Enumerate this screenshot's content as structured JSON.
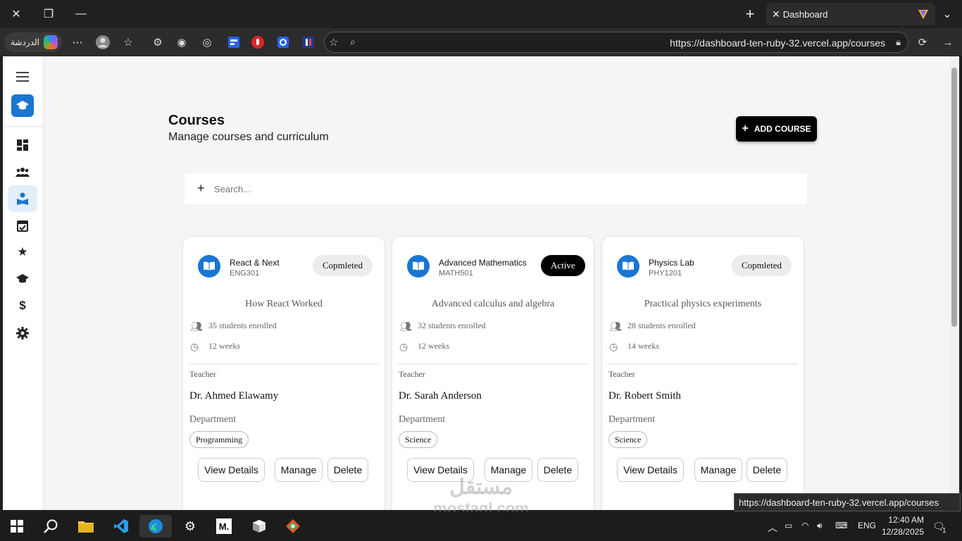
{
  "browser": {
    "tab_title": "Dashboard",
    "chat_label": "الدردشة",
    "url": "https://dashboard-ten-ruby-32.vercel.app/courses",
    "tooltip_url": "https://dashboard-ten-ruby-32.vercel.app/courses"
  },
  "sidebar": {
    "items": [
      {
        "name": "dashboard",
        "icon": "dashboard-icon"
      },
      {
        "name": "students",
        "icon": "people-icon"
      },
      {
        "name": "courses",
        "icon": "course-reader-icon",
        "active": true
      },
      {
        "name": "calendar",
        "icon": "calendar-check-icon"
      },
      {
        "name": "favorites",
        "icon": "star-icon"
      },
      {
        "name": "graduation",
        "icon": "graduation-cap-icon"
      },
      {
        "name": "payments",
        "icon": "dollar-icon"
      },
      {
        "name": "settings",
        "icon": "gear-icon"
      }
    ]
  },
  "header": {
    "title": "Courses",
    "subtitle": "Manage courses and curriculum",
    "add_button_label": "ADD COURSE"
  },
  "search": {
    "placeholder": "Search..."
  },
  "courses": [
    {
      "name": "React & Next",
      "code": "ENG301",
      "status": "Copmleted",
      "description": "How React Worked",
      "students": "35 students enrolled",
      "duration": "12 weeks",
      "teacher_label": "Teacher",
      "teacher": "Dr. Ahmed Elawamy",
      "department_label": "Department",
      "department": "Programming",
      "buttons": [
        "View Details",
        "Manage",
        "Delete"
      ]
    },
    {
      "name": "Advanced Mathematics",
      "code": "MATH501",
      "status": "Active",
      "description": "Advanced calculus and algebra",
      "students": "32 students enrolled",
      "duration": "12 weeks",
      "teacher_label": "Teacher",
      "teacher": "Dr. Sarah Anderson",
      "department_label": "Department",
      "department": "Science",
      "buttons": [
        "View Details",
        "Manage",
        "Delete"
      ]
    },
    {
      "name": "Physics Lab",
      "code": "PHY1201",
      "status": "Copmleted",
      "description": "Practical physics experiments",
      "students": "28 students enrolled",
      "duration": "14 weeks",
      "teacher_label": "Teacher",
      "teacher": "Dr. Robert Smith",
      "department_label": "Department",
      "department": "Science",
      "buttons": [
        "View Details",
        "Manage",
        "Delete"
      ]
    }
  ],
  "taskbar": {
    "language": "ENG",
    "time": "12:40 AM",
    "date": "12/28/2025",
    "notification_count": "1"
  },
  "watermark": {
    "arabic": "مستقل",
    "latin": "mostaql.com"
  },
  "colors": {
    "accent": "#1976d2",
    "active_badge": "#000000"
  }
}
